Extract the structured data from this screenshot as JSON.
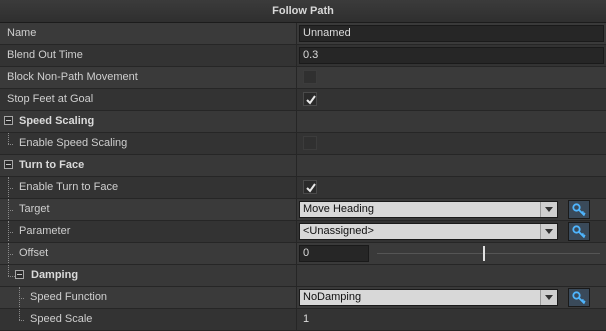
{
  "panel": {
    "title": "Follow Path"
  },
  "props": {
    "name": {
      "label": "Name",
      "value": "Unnamed"
    },
    "blend_out": {
      "label": "Blend Out Time",
      "value": "0.3"
    },
    "block_non_path": {
      "label": "Block Non-Path Movement",
      "checked": false
    },
    "stop_feet": {
      "label": "Stop Feet at Goal",
      "checked": true
    },
    "speed_scaling_group": {
      "label": "Speed Scaling"
    },
    "enable_speed_scaling": {
      "label": "Enable Speed Scaling",
      "checked": false
    },
    "turn_to_face_group": {
      "label": "Turn to Face"
    },
    "enable_turn_to_face": {
      "label": "Enable Turn to Face",
      "checked": true
    },
    "target": {
      "label": "Target",
      "value": "Move Heading"
    },
    "parameter": {
      "label": "Parameter",
      "value": "<Unassigned>"
    },
    "offset": {
      "label": "Offset",
      "value": "0"
    },
    "damping_group": {
      "label": "Damping"
    },
    "speed_function": {
      "label": "Speed Function",
      "value": "NoDamping"
    },
    "speed_scale": {
      "label": "Speed Scale",
      "value": "1"
    }
  },
  "icons": {
    "collapse": "minus-box-icon",
    "check": "checkmark-icon",
    "dropdown": "chevron-down-icon",
    "key": "key-icon"
  }
}
